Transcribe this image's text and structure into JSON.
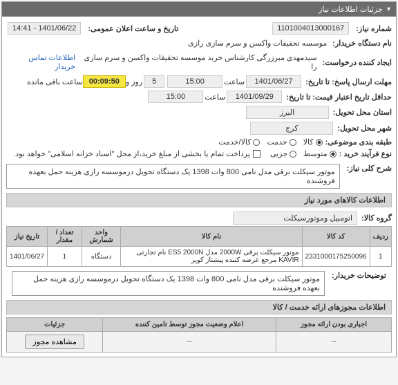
{
  "panel": {
    "title": "جزئیات اطلاعات نیاز",
    "toggle": "▾"
  },
  "fields": {
    "need_number": {
      "label": "شماره نیاز:",
      "value": "1101004013000167"
    },
    "public_announce": {
      "label": "تاریخ و ساعت اعلان عمومی:",
      "value": "1401/06/22 - 14:41"
    },
    "buyer_org": {
      "label": "نام دستگاه خریدار:",
      "value": "موسسه تحقیقات واکسن و سرم سازی رازی"
    },
    "requester": {
      "label": "ایجاد کننده درخواست:",
      "value": "سیدمهدی میرزرگی کارشناس خرید موسسه تحقیقات واکسن و سرم سازی را",
      "contact": "اطلاعات تماس خریدار"
    },
    "response_deadline": {
      "label": "مهلت ارسال پاسخ: تا تاریخ:",
      "date": "1401/06/27",
      "time_label_h": "ساعت",
      "time": "15:00",
      "day_label": "روز و",
      "days": "5",
      "remain_label": "ساعت باقی مانده",
      "timer": "00:09:50"
    },
    "min_valid": {
      "label": "حداقل تاریخ اعتبار قیمت: تا تاریخ:",
      "date": "1401/09/29",
      "time_label_h": "ساعت",
      "time": "15:00"
    },
    "province": {
      "label": "استان محل تحویل:",
      "value": "البرز"
    },
    "city": {
      "label": "شهر محل تحویل:",
      "value": "کرج"
    },
    "category": {
      "label": "طبقه بندی موضوعی:",
      "options": [
        "کالا",
        "خدمت",
        "کالا/خدمت"
      ],
      "selected": 0
    },
    "process": {
      "label": "نوع فرآیند خرید :",
      "options": [
        "متوسط",
        "جزیی"
      ],
      "selected": 0,
      "note_checkbox": "پرداخت تمام یا بخشی از مبلغ خرید،از محل \"اسناد خزانه اسلامی\" خواهد بود."
    }
  },
  "summary": {
    "label": "شرح کلی نیاز:",
    "text": "موتور سیکلت برقی مدل نامی 800 وات  1398 یک دستگاه تحویل درموسسه رازی هزینه حمل بعهده فروشنده"
  },
  "items_section": {
    "header": "اطلاعات کالاهای مورد نیاز",
    "group_label": "گروه کالا:",
    "group_value": "اتومبیل وموتورسیکلت",
    "columns": [
      "ردیف",
      "کد کالا",
      "نام کالا",
      "واحد شمارش",
      "تعداد / مقدار",
      "تاریخ نیاز"
    ],
    "rows": [
      {
        "idx": "1",
        "code": "2331000175250096",
        "name": "موتور سیکلت برقی 2000W مدل ES5 2000N نام تجارتی KAVIR مرجع عرضه کننده پیشتاز کویر",
        "unit": "دستگاه",
        "qty": "1",
        "date": "1401/06/27"
      }
    ],
    "buyer_note_label": "توضیحات خریدار:",
    "buyer_note_text": "موتور سیکلت برقی مدل نامی 800 وات  1398 یک دستگاه تحویل درموسسه رازی هزینه حمل بعهده فروشنده"
  },
  "licenses": {
    "header": "اطلاعات مجوزهای ارائه خدمت / کالا",
    "columns": [
      "اجباری بودن ارائه مجوز",
      "اعلام وضعیت مجوز توسط تامین کننده",
      "جزئیات"
    ],
    "row": {
      "mandatory": "--",
      "status": "--",
      "details_btn": "مشاهده مجوز"
    }
  }
}
